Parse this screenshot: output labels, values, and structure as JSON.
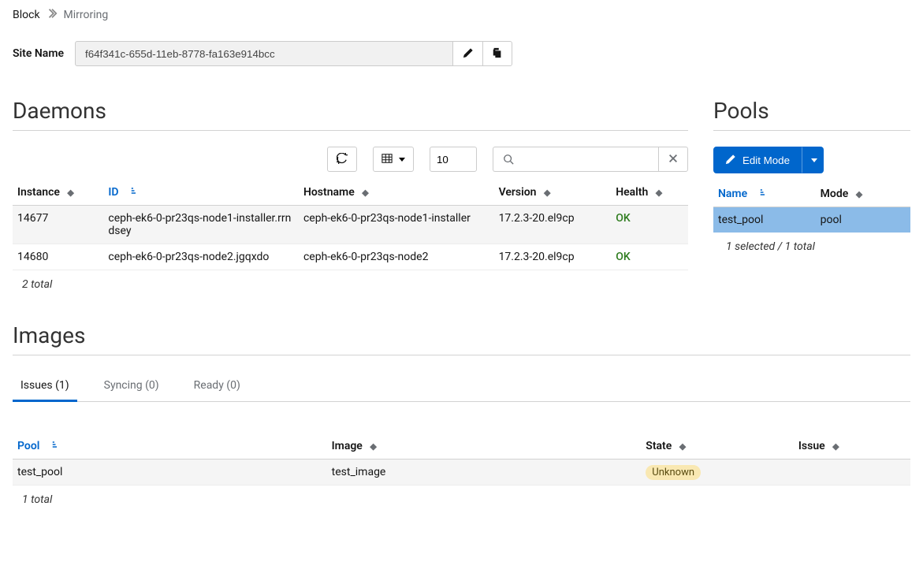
{
  "breadcrumb": {
    "root": "Block",
    "current": "Mirroring"
  },
  "site": {
    "label": "Site Name",
    "value": "f64f341c-655d-11eb-8778-fa163e914bcc"
  },
  "daemons": {
    "heading": "Daemons",
    "page_size": "10",
    "columns": {
      "instance": "Instance",
      "id": "ID",
      "hostname": "Hostname",
      "version": "Version",
      "health": "Health"
    },
    "rows": [
      {
        "instance": "14677",
        "id": "ceph-ek6-0-pr23qs-node1-installer.rrndsey",
        "hostname": "ceph-ek6-0-pr23qs-node1-installer",
        "version": "17.2.3-20.el9cp",
        "health": "OK"
      },
      {
        "instance": "14680",
        "id": "ceph-ek6-0-pr23qs-node2.jgqxdo",
        "hostname": "ceph-ek6-0-pr23qs-node2",
        "version": "17.2.3-20.el9cp",
        "health": "OK"
      }
    ],
    "total": "2 total"
  },
  "pools": {
    "heading": "Pools",
    "edit_label": "Edit Mode",
    "columns": {
      "name": "Name",
      "mode": "Mode"
    },
    "rows": [
      {
        "name": "test_pool",
        "mode": "pool"
      }
    ],
    "footer": "1 selected / 1 total"
  },
  "images": {
    "heading": "Images",
    "tabs": {
      "issues": "Issues (1)",
      "syncing": "Syncing (0)",
      "ready": "Ready (0)"
    },
    "columns": {
      "pool": "Pool",
      "image": "Image",
      "state": "State",
      "issue": "Issue"
    },
    "rows": [
      {
        "pool": "test_pool",
        "image": "test_image",
        "state": "Unknown",
        "issue": ""
      }
    ],
    "total": "1 total"
  }
}
